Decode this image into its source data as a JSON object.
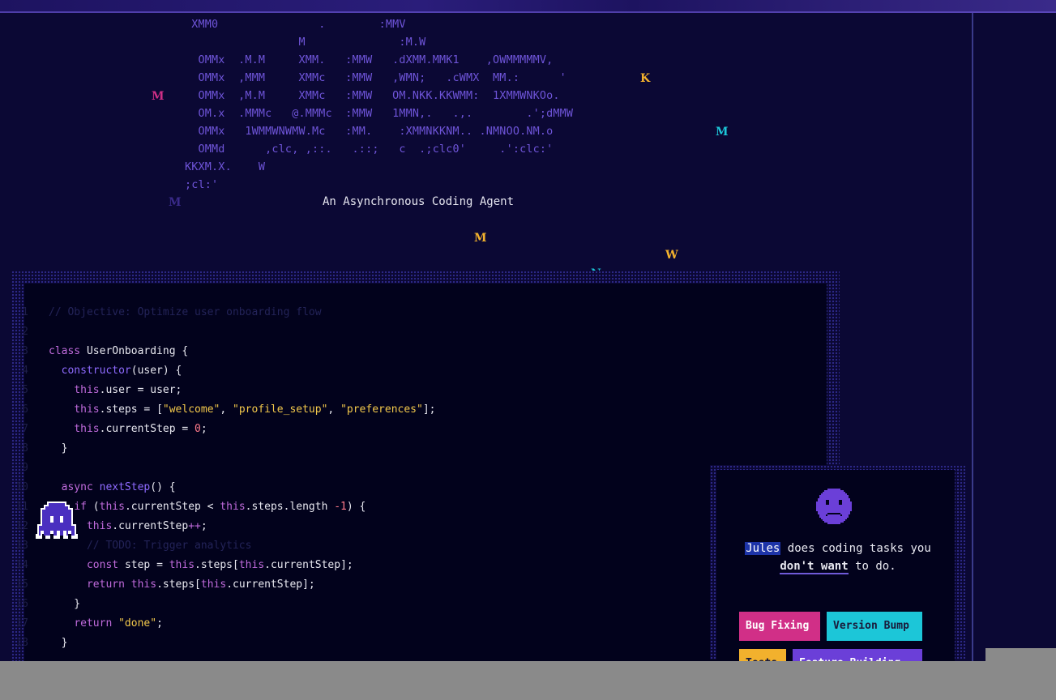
{
  "logo_ascii": " XMM0               .        :MMV\n                 M              :M.W\n  OMMx  .M.M     XMM.   :MMW   .dXMM.MMK1    ,OWMMMMMV,\n  OMMx  ,MMM     XMMc   :MMW   ,WMN;   .cWMX  MM.:      '\n  OMMx  ,M.M     XMMc   :MMW   OM.NKK.KKWMM:  1XMMWNKOo.\n  OM.x  .MMMc   @.MMMc  :MMW   1MMN,.   .,.        .';dMMW\n  OMMx   1WMMWNWMW.Mc   :MM.    :XMMNKKNM.. .NMNOO.NM.o\n  OMMd      ,clc, ,::.   .::;   c  .;clc0'     .':clc:'\nKKXM.X.    W\n;cl:'",
  "subtitle": "An Asynchronous Coding Agent",
  "glyphs": [
    {
      "char": "M",
      "color": "#d12f87"
    },
    {
      "char": "K",
      "color": "#f2b12d"
    },
    {
      "char": "M",
      "color": "#1cc6d8"
    },
    {
      "char": "M",
      "color": "#f2b12d"
    },
    {
      "char": "W",
      "color": "#f2b12d"
    },
    {
      "char": "N",
      "color": "#1cc6d8"
    },
    {
      "char": "M",
      "color": "#3a2a8a"
    }
  ],
  "code": {
    "lines": [
      {
        "n": "1",
        "segs": [
          {
            "t": "// Objective: Optimize user onboarding flow",
            "c": "cm"
          }
        ]
      },
      {
        "n": "2",
        "segs": []
      },
      {
        "n": "3",
        "segs": [
          {
            "t": "class ",
            "c": "kw"
          },
          {
            "t": "UserOnboarding {",
            "c": ""
          }
        ]
      },
      {
        "n": "4",
        "segs": [
          {
            "t": "  ",
            "c": ""
          },
          {
            "t": "constructor",
            "c": "fn"
          },
          {
            "t": "(user) {",
            "c": ""
          }
        ]
      },
      {
        "n": "5",
        "segs": [
          {
            "t": "    ",
            "c": ""
          },
          {
            "t": "this",
            "c": "kw"
          },
          {
            "t": ".user = user;",
            "c": ""
          }
        ]
      },
      {
        "n": "6",
        "segs": [
          {
            "t": "    ",
            "c": ""
          },
          {
            "t": "this",
            "c": "kw"
          },
          {
            "t": ".steps = [",
            "c": ""
          },
          {
            "t": "\"welcome\"",
            "c": "str"
          },
          {
            "t": ", ",
            "c": ""
          },
          {
            "t": "\"profile_setup\"",
            "c": "str"
          },
          {
            "t": ", ",
            "c": ""
          },
          {
            "t": "\"preferences\"",
            "c": "str"
          },
          {
            "t": "];",
            "c": ""
          }
        ]
      },
      {
        "n": "7",
        "segs": [
          {
            "t": "    ",
            "c": ""
          },
          {
            "t": "this",
            "c": "kw"
          },
          {
            "t": ".currentStep = ",
            "c": ""
          },
          {
            "t": "0",
            "c": "num"
          },
          {
            "t": ";",
            "c": ""
          }
        ]
      },
      {
        "n": "8",
        "segs": [
          {
            "t": "  }",
            "c": ""
          }
        ]
      },
      {
        "n": "9",
        "segs": []
      },
      {
        "n": "10",
        "segs": [
          {
            "t": "  ",
            "c": ""
          },
          {
            "t": "async ",
            "c": "kw"
          },
          {
            "t": "nextStep",
            "c": "fn"
          },
          {
            "t": "() {",
            "c": ""
          }
        ]
      },
      {
        "n": "11",
        "segs": [
          {
            "t": "    ",
            "c": ""
          },
          {
            "t": "if ",
            "c": "kw"
          },
          {
            "t": "(",
            "c": ""
          },
          {
            "t": "this",
            "c": "kw"
          },
          {
            "t": ".currentStep < ",
            "c": ""
          },
          {
            "t": "this",
            "c": "kw"
          },
          {
            "t": ".steps.length ",
            "c": ""
          },
          {
            "t": "-1",
            "c": "num"
          },
          {
            "t": ") {",
            "c": ""
          }
        ]
      },
      {
        "n": "12",
        "segs": [
          {
            "t": "      ",
            "c": ""
          },
          {
            "t": "this",
            "c": "kw"
          },
          {
            "t": ".currentStep",
            "c": ""
          },
          {
            "t": "++",
            "c": "kw"
          },
          {
            "t": ";",
            "c": ""
          }
        ]
      },
      {
        "n": "13",
        "segs": [
          {
            "t": "      // TODO: Trigger analytics",
            "c": "cm"
          }
        ]
      },
      {
        "n": "14",
        "segs": [
          {
            "t": "      ",
            "c": ""
          },
          {
            "t": "const ",
            "c": "kw"
          },
          {
            "t": "step = ",
            "c": ""
          },
          {
            "t": "this",
            "c": "kw"
          },
          {
            "t": ".steps[",
            "c": ""
          },
          {
            "t": "this",
            "c": "kw"
          },
          {
            "t": ".currentStep];",
            "c": ""
          }
        ]
      },
      {
        "n": "15",
        "segs": [
          {
            "t": "      ",
            "c": ""
          },
          {
            "t": "return ",
            "c": "kw"
          },
          {
            "t": "this",
            "c": "kw"
          },
          {
            "t": ".steps[",
            "c": ""
          },
          {
            "t": "this",
            "c": "kw"
          },
          {
            "t": ".currentStep];",
            "c": ""
          }
        ]
      },
      {
        "n": "16",
        "segs": [
          {
            "t": "    }",
            "c": ""
          }
        ]
      },
      {
        "n": "17",
        "segs": [
          {
            "t": "    ",
            "c": ""
          },
          {
            "t": "return ",
            "c": "kw"
          },
          {
            "t": "\"done\"",
            "c": "str"
          },
          {
            "t": ";",
            "c": ""
          }
        ]
      },
      {
        "n": "18",
        "segs": [
          {
            "t": "  }",
            "c": ""
          }
        ]
      }
    ]
  },
  "card": {
    "name_highlight": "Jules",
    "line1_rest": " does coding tasks you",
    "emphasis": "don't want",
    "line2_rest": " to do.",
    "chips": [
      "Bug Fixing",
      "Version Bump",
      "Tests",
      "Feature Building"
    ]
  },
  "colors": {
    "background": "#0b0834",
    "editor_bg": "#02021c",
    "logo": "#6e54d8",
    "pink": "#d12f87",
    "cyan": "#1cc6d8",
    "yellow": "#f2b12d",
    "purple": "#6b3fd8"
  },
  "icons": {
    "mascot": "octopus-mascot-icon",
    "sad_face": "sad-face-icon"
  }
}
